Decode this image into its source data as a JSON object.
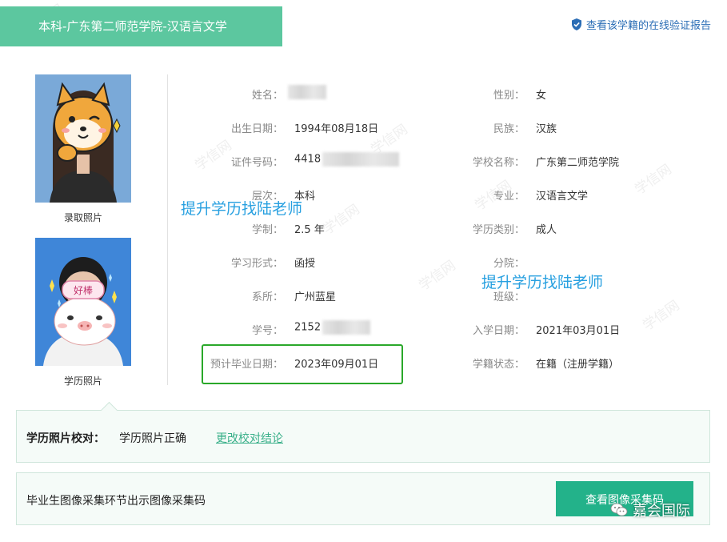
{
  "header": {
    "title": "本科-广东第二师范学院-汉语言文学",
    "verify_link": "查看该学籍的在线验证报告"
  },
  "photos": {
    "admission_caption": "录取照片",
    "degree_caption": "学历照片",
    "sticker_text": "好棒"
  },
  "info_left": [
    {
      "label": "姓名：",
      "value": ""
    },
    {
      "label": "出生日期：",
      "value": "1994年08月18日"
    },
    {
      "label": "证件号码：",
      "value": "4418"
    },
    {
      "label": "层次：",
      "value": "本科"
    },
    {
      "label": "学制：",
      "value": "2.5 年"
    },
    {
      "label": "学习形式：",
      "value": "函授"
    },
    {
      "label": "系所：",
      "value": "广州蓝星"
    },
    {
      "label": "学号：",
      "value": "2152"
    },
    {
      "label": "预计毕业日期：",
      "value": "2023年09月01日"
    }
  ],
  "info_right": [
    {
      "label": "性别：",
      "value": "女"
    },
    {
      "label": "民族：",
      "value": "汉族"
    },
    {
      "label": "学校名称：",
      "value": "广东第二师范学院"
    },
    {
      "label": "专业：",
      "value": "汉语言文学"
    },
    {
      "label": "学历类别：",
      "value": "成人"
    },
    {
      "label": "分院：",
      "value": ""
    },
    {
      "label": "班级：",
      "value": ""
    },
    {
      "label": "入学日期：",
      "value": "2021年03月01日"
    },
    {
      "label": "学籍状态：",
      "value": "在籍（注册学籍）"
    }
  ],
  "overlay": {
    "promo_1": "提升学历找陆老师",
    "promo_2": "提升学历找陆老师",
    "faint_watermark": "学信网"
  },
  "photo_check": {
    "label": "学历照片校对：",
    "value": "学历照片正确",
    "link": "更改校对结论"
  },
  "image_collection": {
    "text": "毕业生图像采集环节出示图像采集码",
    "button": "查看图像采集码"
  },
  "wechat_badge": {
    "name": "嘉会国际"
  },
  "colors": {
    "header_green": "#5cc79f",
    "button_green": "#23b28a",
    "link_blue": "#2a6db5",
    "promo_blue": "#28a0e0",
    "highlight_green": "#2aa82a"
  }
}
